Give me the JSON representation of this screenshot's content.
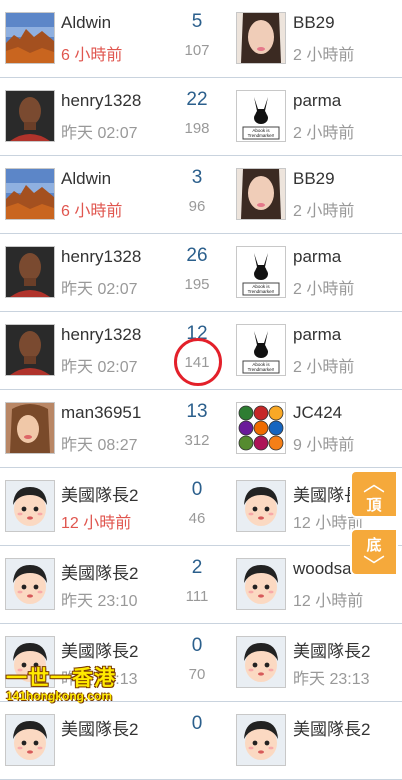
{
  "rows": [
    {
      "left_user": "Aldwin",
      "left_time": "6 小時前",
      "left_time_red": true,
      "left_avatar": "landscape",
      "replies": "5",
      "views": "107",
      "right_user": "BB29",
      "right_time": "2 小時前",
      "right_time_red": false,
      "right_avatar": "woman"
    },
    {
      "left_user": "henry1328",
      "left_time": "昨天 02:07",
      "left_time_red": false,
      "left_avatar": "man",
      "replies": "22",
      "views": "198",
      "right_user": "parma",
      "right_time": "2 小時前",
      "right_time_red": false,
      "right_avatar": "bunny"
    },
    {
      "left_user": "Aldwin",
      "left_time": "6 小時前",
      "left_time_red": true,
      "left_avatar": "landscape",
      "replies": "3",
      "views": "96",
      "right_user": "BB29",
      "right_time": "2 小時前",
      "right_time_red": false,
      "right_avatar": "woman"
    },
    {
      "left_user": "henry1328",
      "left_time": "昨天 02:07",
      "left_time_red": false,
      "left_avatar": "man",
      "replies": "26",
      "views": "195",
      "right_user": "parma",
      "right_time": "2 小時前",
      "right_time_red": false,
      "right_avatar": "bunny"
    },
    {
      "left_user": "henry1328",
      "left_time": "昨天 02:07",
      "left_time_red": false,
      "left_avatar": "man",
      "replies": "12",
      "views": "141",
      "right_user": "parma",
      "right_time": "2 小時前",
      "right_time_red": false,
      "right_avatar": "bunny"
    },
    {
      "left_user": "man36951",
      "left_time": "昨天 08:27",
      "left_time_red": false,
      "left_avatar": "girl",
      "replies": "13",
      "views": "312",
      "right_user": "JC424",
      "right_time": "9 小時前",
      "right_time_red": false,
      "right_avatar": "badges"
    },
    {
      "left_user": "美國隊長2",
      "left_time": "12 小時前",
      "left_time_red": true,
      "left_avatar": "cartoon",
      "replies": "0",
      "views": "46",
      "right_user": "美國隊長2",
      "right_time": "12 小時前",
      "right_time_red": false,
      "right_avatar": "cartoon"
    },
    {
      "left_user": "美國隊長2",
      "left_time": "昨天 23:10",
      "left_time_red": false,
      "left_avatar": "cartoon",
      "replies": "2",
      "views": "111",
      "right_user": "woodsand",
      "right_time": "12 小時前",
      "right_time_red": false,
      "right_avatar": "cartoon"
    },
    {
      "left_user": "美國隊長2",
      "left_time": "昨天 23:13",
      "left_time_red": false,
      "left_avatar": "cartoon",
      "replies": "0",
      "views": "70",
      "right_user": "美國隊長2",
      "right_time": "昨天 23:13",
      "right_time_red": false,
      "right_avatar": "cartoon"
    },
    {
      "left_user": "美國隊長2",
      "left_time": "",
      "left_time_red": false,
      "left_avatar": "cartoon",
      "replies": "0",
      "views": "",
      "right_user": "美國隊長2",
      "right_time": "",
      "right_time_red": false,
      "right_avatar": "cartoon"
    }
  ],
  "bunny_caption_1": "Abook is",
  "bunny_caption_2": "Trendmarker!",
  "side": {
    "top_label": "頂",
    "bottom_label": "底"
  },
  "logo": {
    "main": "一世一香港",
    "sub": "141hongkong.com"
  },
  "colors": {
    "replies": "#2b5f8c",
    "red_time": "#e0564f",
    "highlight_circle": "#e3202a",
    "side_button": "#f5a93b"
  }
}
